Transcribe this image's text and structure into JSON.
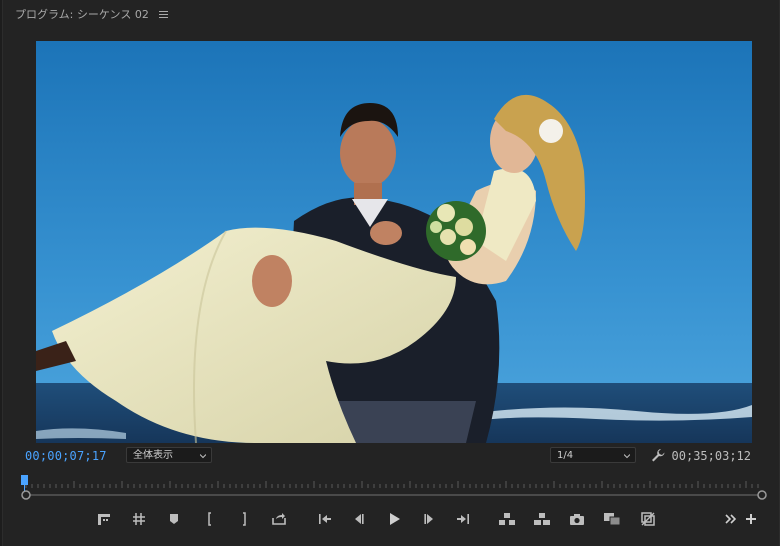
{
  "panel": {
    "title": "プログラム: シーケンス 02",
    "menu_icon": "hamburger-menu-icon"
  },
  "timecode": {
    "current": "00;00;07;17",
    "duration": "00;35;03;12",
    "current_color": "#4aa3ff"
  },
  "zoom": {
    "selected": "全体表示"
  },
  "resolution": {
    "selected": "1/4"
  },
  "playhead": {
    "position_fraction": 0.0,
    "color": "#4aa3ff"
  },
  "controls": {
    "left": [
      "marker-filmstrip-icon",
      "safe-margins-grid-icon",
      "add-marker-icon",
      "mark-in-icon",
      "mark-out-icon",
      "export-frame-loop-icon"
    ],
    "center": [
      "go-to-in-icon",
      "step-back-icon",
      "play-icon",
      "step-forward-icon",
      "go-to-out-icon"
    ],
    "right": [
      "lift-icon",
      "extract-icon",
      "camera-icon",
      "comparison-view-icon",
      "proxy-toggle-icon"
    ],
    "overflow": [
      "more-chevron-icon",
      "add-button-icon"
    ]
  }
}
